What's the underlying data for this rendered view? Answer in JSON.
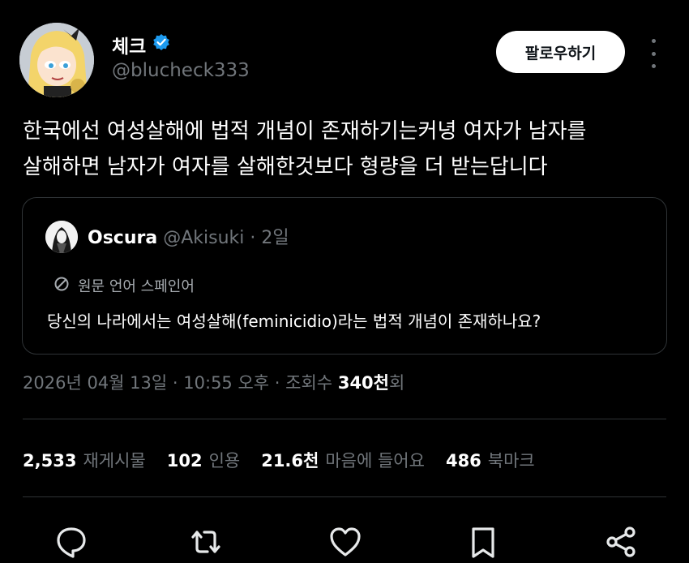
{
  "author": {
    "display_name": "체크",
    "handle": "@blucheck333",
    "verified_icon": "verified-badge-icon",
    "follow_label": "팔로우하기"
  },
  "tweet": {
    "text_line1": "한국에선 여성살해에 법적 개념이 존재하기는커녕 여자가 남자를",
    "text_line2": "살해하면 남자가 여자를 살해한것보다 형량을 더 받는답니다"
  },
  "quote": {
    "display_name": "Oscura",
    "handle": "@Akisuki",
    "separator": "·",
    "age": "2일",
    "language_note": "원문 언어 스페인어",
    "text": "당신의 나라에서는 여성살해(feminicidio)라는 법적 개념이 존재하나요?"
  },
  "meta": {
    "date": "2026년 04월 13일",
    "sep1": "·",
    "time": "10:55 오후",
    "sep2": "·",
    "views_label": "조회수",
    "views_number": "340천",
    "views_suffix": "회"
  },
  "stats": {
    "reposts_count": "2,533",
    "reposts_label": "재게시물",
    "quotes_count": "102",
    "quotes_label": "인용",
    "likes_count": "21.6천",
    "likes_label": "마음에 들어요",
    "bookmarks_count": "486",
    "bookmarks_label": "북마크"
  },
  "actions": [
    "reply-icon",
    "repost-icon",
    "like-icon",
    "bookmark-icon",
    "share-icon"
  ],
  "colors": {
    "background": "#000000",
    "text": "#ffffff",
    "muted": "#71767b",
    "verified": "#1d9bf0",
    "border": "#2f3336"
  }
}
